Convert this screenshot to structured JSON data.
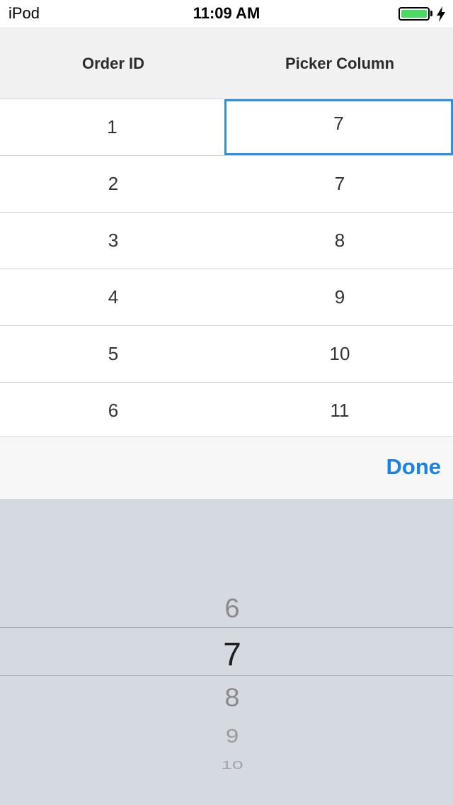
{
  "status_bar": {
    "device": "iPod",
    "time": "11:09 AM",
    "battery_color": "#4cd964",
    "battery_level": 1.0
  },
  "grid": {
    "columns": [
      "Order ID",
      "Picker Column"
    ],
    "rows": [
      {
        "order_id": "1",
        "picker": "7"
      },
      {
        "order_id": "2",
        "picker": "7"
      },
      {
        "order_id": "3",
        "picker": "8"
      },
      {
        "order_id": "4",
        "picker": "9"
      },
      {
        "order_id": "5",
        "picker": "10"
      },
      {
        "order_id": "6",
        "picker": "11"
      }
    ],
    "editing_row": 0,
    "accent_color": "#2f8fe0"
  },
  "toolbar": {
    "done_label": "Done",
    "accent_color": "#1a82e6"
  },
  "picker": {
    "visible_items": [
      "6",
      "7",
      "8",
      "9",
      "10"
    ],
    "selected": "7"
  }
}
